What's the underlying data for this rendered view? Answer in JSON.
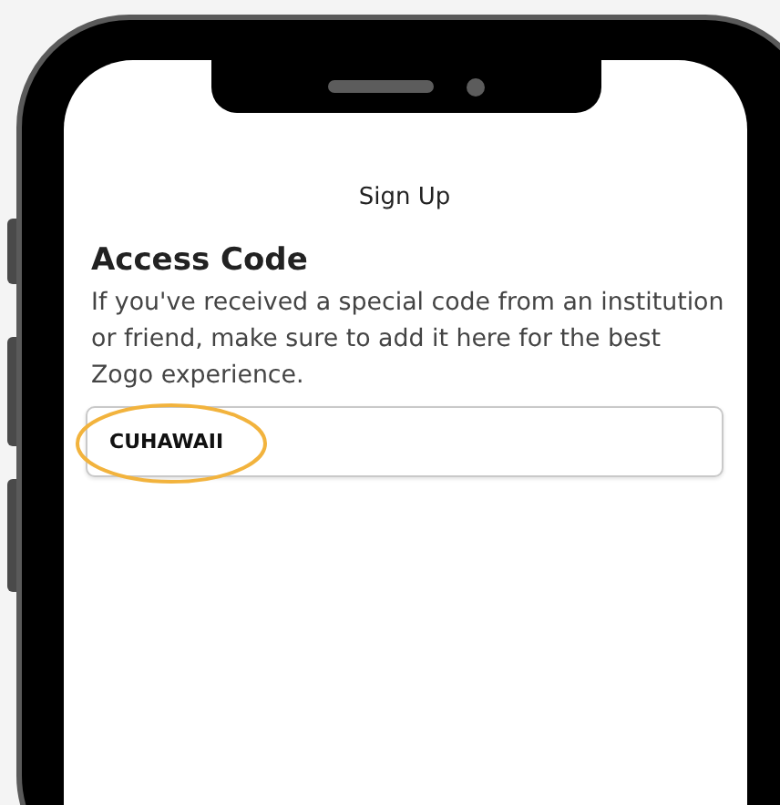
{
  "screen": {
    "title": "Sign Up",
    "heading": "Access Code",
    "description": "If you've received a special code from an institution or friend, make sure to add it here for the best Zogo experience.",
    "access_code_field": {
      "value": "CUHAWAII",
      "highlighted": true
    }
  }
}
